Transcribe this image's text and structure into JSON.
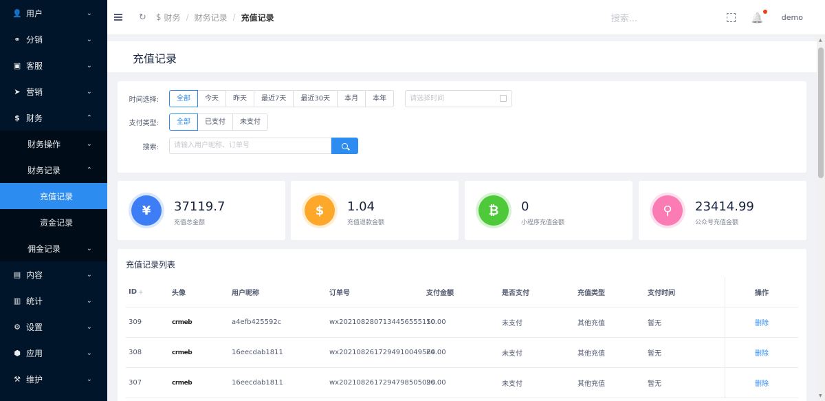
{
  "sidebar": {
    "items": [
      {
        "icon": "user-icon",
        "glyph": "👤",
        "label": "用户",
        "chev": "⌄"
      },
      {
        "icon": "distribution-icon",
        "glyph": "⚭",
        "label": "分销",
        "chev": "⌄"
      },
      {
        "icon": "chat-icon",
        "glyph": "▣",
        "label": "客服",
        "chev": "⌄"
      },
      {
        "icon": "send-icon",
        "glyph": "➤",
        "label": "营销",
        "chev": "⌄"
      },
      {
        "icon": "dollar-icon",
        "glyph": "$",
        "label": "财务",
        "chev": "⌃"
      },
      {
        "label": "财务操作",
        "chev": "⌄"
      },
      {
        "label": "财务记录",
        "chev": "⌃"
      },
      {
        "label": "充值记录"
      },
      {
        "label": "资金记录"
      },
      {
        "label": "佣金记录",
        "chev": "⌄"
      },
      {
        "icon": "book-icon",
        "glyph": "▤",
        "label": "内容",
        "chev": "⌄"
      },
      {
        "icon": "bar-chart-icon",
        "glyph": "▥",
        "label": "统计",
        "chev": "⌄"
      },
      {
        "icon": "gear-icon",
        "glyph": "⚙",
        "label": "设置",
        "chev": "⌄"
      },
      {
        "icon": "cube-icon",
        "glyph": "⬢",
        "label": "应用",
        "chev": "⌄"
      },
      {
        "icon": "wrench-icon",
        "glyph": "⚒",
        "label": "维护",
        "chev": "⌄"
      }
    ]
  },
  "header": {
    "refresh_glyph": "↻",
    "breadcrumb": {
      "icon_glyph": "$",
      "first": "财务",
      "sep": "/",
      "second": "财务记录",
      "current": "充值记录"
    },
    "search_placeholder": "搜索...",
    "bell_glyph": "🔔",
    "user": "demo"
  },
  "page": {
    "title": "充值记录"
  },
  "filters": {
    "time_label": "时间选择:",
    "time_options": [
      "全部",
      "今天",
      "昨天",
      "最近7天",
      "最近30天",
      "本月",
      "本年"
    ],
    "date_placeholder": "请选择时间",
    "pay_label": "支付类型:",
    "pay_options": [
      "全部",
      "已支付",
      "未支付"
    ],
    "search_label": "搜索:",
    "search_placeholder": "请输入用户昵称、订单号"
  },
  "stats": [
    {
      "icon": "yen-icon",
      "glyph": "¥",
      "color": "#3d7ef6",
      "value": "37119.7",
      "label": "充值总金额"
    },
    {
      "icon": "dollar-coin-icon",
      "glyph": "$",
      "color": "#fea82b",
      "value": "1.04",
      "label": "充值退款金额"
    },
    {
      "icon": "bitcoin-icon",
      "glyph": "₿",
      "color": "#4dc93a",
      "value": "0",
      "label": "小程序充值金额"
    },
    {
      "icon": "bike-icon",
      "glyph": "⚲",
      "color": "#fb7bb4",
      "value": "23414.99",
      "label": "公众号充值金额"
    }
  ],
  "table": {
    "title": "充值记录列表",
    "headers": {
      "id": "ID",
      "avatar": "头像",
      "name": "用户昵称",
      "order": "订单号",
      "amount": "支付金额",
      "paid": "是否支付",
      "type": "充值类型",
      "time": "支付时间",
      "op": "操作"
    },
    "sort_glyph": "≑",
    "rows": [
      {
        "id": "309",
        "avatar": "crmeb",
        "name": "a4efb425592c",
        "order": "wx2021082807134456555150",
        "amount": "10.00",
        "paid": "未支付",
        "type": "其他充值",
        "time": "暂无",
        "op": "删除"
      },
      {
        "id": "308",
        "avatar": "crmeb",
        "name": "16eecdab1811",
        "order": "wx2021082617294910049564",
        "amount": "20.00",
        "paid": "未支付",
        "type": "其他充值",
        "time": "暂无",
        "op": "删除"
      },
      {
        "id": "307",
        "avatar": "crmeb",
        "name": "16eecdab1811",
        "order": "wx2021082617294798505098",
        "amount": "20.00",
        "paid": "未支付",
        "type": "其他充值",
        "time": "暂无",
        "op": "删除"
      }
    ]
  }
}
